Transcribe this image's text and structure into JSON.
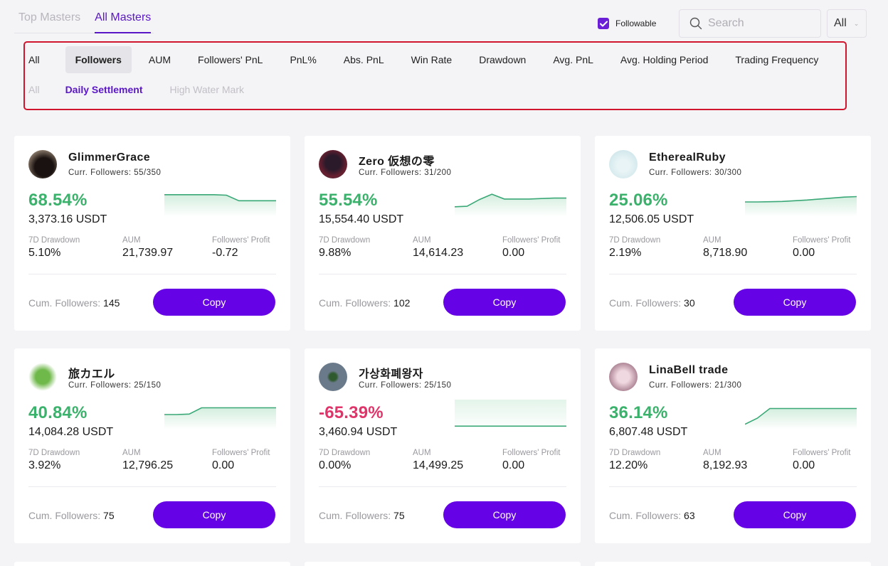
{
  "top_tabs": [
    {
      "label": "Top Masters",
      "active": false
    },
    {
      "label": "All Masters",
      "active": true
    }
  ],
  "controls": {
    "followable_label": "Followable",
    "followable_checked": true,
    "search_placeholder": "Search",
    "select_value": "All",
    "icons": {
      "search": "search-icon",
      "checkbox": "check-icon",
      "select": "chevron-down-icon"
    }
  },
  "sort_filters": [
    "All",
    "Followers",
    "AUM",
    "Followers' PnL",
    "PnL%",
    "Abs. PnL",
    "Win Rate",
    "Drawdown",
    "Avg. PnL",
    "Avg. Holding Period",
    "Trading Frequency"
  ],
  "sort_selected": "Followers",
  "settlement_filters": [
    "All",
    "Daily Settlement",
    "High Water Mark"
  ],
  "settlement_selected": "Daily Settlement",
  "labels": {
    "drawdown": "7D Drawdown",
    "aum": "AUM",
    "followers_profit": "Followers' Profit",
    "cum_followers": "Cum. Followers:",
    "copy": "Copy"
  },
  "colors": {
    "accent": "#6502e6",
    "positive": "#3ab26b",
    "negative": "#e0356a",
    "highlight_border": "#d0162f"
  },
  "masters": [
    {
      "name": "GlimmerGrace",
      "curr_followers": "Curr. Followers: 55/350",
      "pnl_pct": "68.54%",
      "pnl_usdt": "3,373.16 USDT",
      "positive": true,
      "drawdown": "5.10%",
      "aum": "21,739.97",
      "followers_profit": "-0.72",
      "cum_followers": "145",
      "trend": [
        0.8,
        0.8,
        0.8,
        0.8,
        0.8,
        0.78,
        0.55,
        0.55,
        0.55,
        0.55
      ]
    },
    {
      "name": "Zero 仮想の零",
      "curr_followers": "Curr. Followers: 31/200",
      "pnl_pct": "55.54%",
      "pnl_usdt": "15,554.40 USDT",
      "positive": true,
      "drawdown": "9.88%",
      "aum": "14,614.23",
      "followers_profit": "0.00",
      "cum_followers": "102",
      "trend": [
        0.3,
        0.32,
        0.6,
        0.82,
        0.62,
        0.62,
        0.62,
        0.64,
        0.66,
        0.66
      ]
    },
    {
      "name": "EtherealRuby",
      "curr_followers": "Curr. Followers: 30/300",
      "pnl_pct": "25.06%",
      "pnl_usdt": "12,506.05 USDT",
      "positive": true,
      "drawdown": "2.19%",
      "aum": "8,718.90",
      "followers_profit": "0.00",
      "cum_followers": "30",
      "trend": [
        0.5,
        0.5,
        0.51,
        0.52,
        0.55,
        0.58,
        0.62,
        0.66,
        0.7,
        0.72
      ]
    },
    {
      "name": "旅カエル",
      "curr_followers": "Curr. Followers: 25/150",
      "pnl_pct": "40.84%",
      "pnl_usdt": "14,084.28 USDT",
      "positive": true,
      "drawdown": "3.92%",
      "aum": "12,796.25",
      "followers_profit": "0.00",
      "cum_followers": "75",
      "trend": [
        0.5,
        0.5,
        0.52,
        0.78,
        0.78,
        0.78,
        0.78,
        0.78,
        0.78,
        0.78
      ]
    },
    {
      "name": "가상화폐왕자",
      "curr_followers": "Curr. Followers: 25/150",
      "pnl_pct": "-65.39%",
      "pnl_usdt": "3,460.94 USDT",
      "positive": false,
      "drawdown": "0.00%",
      "aum": "14,499.25",
      "followers_profit": "0.00",
      "cum_followers": "75",
      "trend": [
        0.02,
        0.02,
        0.02,
        0.02,
        0.02,
        0.02,
        0.02,
        0.02,
        0.02,
        0.02
      ]
    },
    {
      "name": "LinaBell trade",
      "curr_followers": "Curr. Followers: 21/300",
      "pnl_pct": "36.14%",
      "pnl_usdt": "6,807.48 USDT",
      "positive": true,
      "drawdown": "12.20%",
      "aum": "8,192.93",
      "followers_profit": "0.00",
      "cum_followers": "63",
      "trend": [
        0.1,
        0.35,
        0.75,
        0.75,
        0.75,
        0.75,
        0.75,
        0.75,
        0.75,
        0.75
      ]
    }
  ]
}
